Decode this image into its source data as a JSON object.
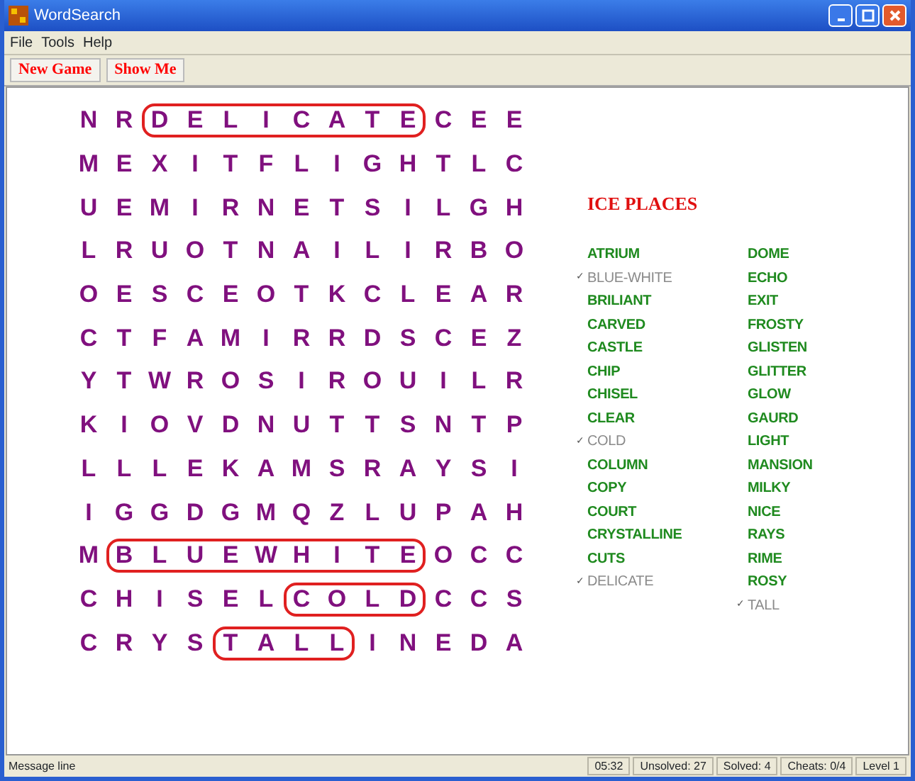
{
  "window": {
    "title": "WordSearch"
  },
  "menu": [
    "File",
    "Tools",
    "Help"
  ],
  "toolbar": [
    "New Game",
    "Show Me"
  ],
  "grid": [
    [
      {
        "letters": [
          "N",
          "R"
        ],
        "circled": false
      },
      {
        "letters": [
          "D",
          "E",
          "L",
          "I",
          "C",
          "A",
          "T",
          "E"
        ],
        "circled": true
      },
      {
        "letters": [
          "C",
          "E",
          "E"
        ],
        "circled": false
      }
    ],
    [
      {
        "letters": [
          "M",
          "E",
          "X",
          "I",
          "T",
          "F",
          "L",
          "I",
          "G",
          "H",
          "T",
          "L",
          "C"
        ],
        "circled": false
      }
    ],
    [
      {
        "letters": [
          "U",
          "E",
          "M",
          "I",
          "R",
          "N",
          "E",
          "T",
          "S",
          "I",
          "L",
          "G",
          "H"
        ],
        "circled": false
      }
    ],
    [
      {
        "letters": [
          "L",
          "R",
          "U",
          "O",
          "T",
          "N",
          "A",
          "I",
          "L",
          "I",
          "R",
          "B",
          "O"
        ],
        "circled": false
      }
    ],
    [
      {
        "letters": [
          "O",
          "E",
          "S",
          "C",
          "E",
          "O",
          "T",
          "K",
          "C",
          "L",
          "E",
          "A",
          "R"
        ],
        "circled": false
      }
    ],
    [
      {
        "letters": [
          "C",
          "T",
          "F",
          "A",
          "M",
          "I",
          "R",
          "R",
          "D",
          "S",
          "C",
          "E",
          "Z"
        ],
        "circled": false
      }
    ],
    [
      {
        "letters": [
          "Y",
          "T",
          "W",
          "R",
          "O",
          "S",
          "I",
          "R",
          "O",
          "U",
          "I",
          "L",
          "R"
        ],
        "circled": false
      }
    ],
    [
      {
        "letters": [
          "K",
          "I",
          "O",
          "V",
          "D",
          "N",
          "U",
          "T",
          "T",
          "S",
          "N",
          "T",
          "P"
        ],
        "circled": false
      }
    ],
    [
      {
        "letters": [
          "L",
          "L",
          "L",
          "E",
          "K",
          "A",
          "M",
          "S",
          "R",
          "A",
          "Y",
          "S",
          "I"
        ],
        "circled": false
      }
    ],
    [
      {
        "letters": [
          "I",
          "G",
          "G",
          "D",
          "G",
          "M",
          "Q",
          "Z",
          "L",
          "U",
          "P",
          "A",
          "H"
        ],
        "circled": false
      }
    ],
    [
      {
        "letters": [
          "M"
        ],
        "circled": false
      },
      {
        "letters": [
          "B",
          "L",
          "U",
          "E",
          "W",
          "H",
          "I",
          "T",
          "E"
        ],
        "circled": true
      },
      {
        "letters": [
          "O",
          "C",
          "C"
        ],
        "circled": false
      }
    ],
    [
      {
        "letters": [
          "C",
          "H",
          "I",
          "S",
          "E",
          "L"
        ],
        "circled": false
      },
      {
        "letters": [
          "C",
          "O",
          "L",
          "D"
        ],
        "circled": true
      },
      {
        "letters": [
          "C",
          "C",
          "S"
        ],
        "circled": false
      }
    ],
    [
      {
        "letters": [
          "C",
          "R",
          "Y",
          "S"
        ],
        "circled": false
      },
      {
        "letters": [
          "T",
          "A",
          "L",
          "L"
        ],
        "circled": true
      },
      {
        "letters": [
          "I",
          "N",
          "E",
          "D",
          "A"
        ],
        "circled": false
      }
    ]
  ],
  "word_list": {
    "title": "ICE PLACES",
    "columns": [
      [
        {
          "word": "ATRIUM",
          "found": false
        },
        {
          "word": "BLUE-WHITE",
          "found": true
        },
        {
          "word": "BRILIANT",
          "found": false
        },
        {
          "word": "CARVED",
          "found": false
        },
        {
          "word": "CASTLE",
          "found": false
        },
        {
          "word": "CHIP",
          "found": false
        },
        {
          "word": "CHISEL",
          "found": false
        },
        {
          "word": "CLEAR",
          "found": false
        },
        {
          "word": "COLD",
          "found": true
        },
        {
          "word": "COLUMN",
          "found": false
        },
        {
          "word": "COPY",
          "found": false
        },
        {
          "word": "COURT",
          "found": false
        },
        {
          "word": "CRYSTALLINE",
          "found": false
        },
        {
          "word": "CUTS",
          "found": false
        },
        {
          "word": "DELICATE",
          "found": true
        }
      ],
      [
        {
          "word": "DOME",
          "found": false
        },
        {
          "word": "ECHO",
          "found": false
        },
        {
          "word": "EXIT",
          "found": false
        },
        {
          "word": "FROSTY",
          "found": false
        },
        {
          "word": "GLISTEN",
          "found": false
        },
        {
          "word": "GLITTER",
          "found": false
        },
        {
          "word": "GLOW",
          "found": false
        },
        {
          "word": "GAURD",
          "found": false
        },
        {
          "word": "LIGHT",
          "found": false
        },
        {
          "word": "MANSION",
          "found": false
        },
        {
          "word": "MILKY",
          "found": false
        },
        {
          "word": "NICE",
          "found": false
        },
        {
          "word": "RAYS",
          "found": false
        },
        {
          "word": "RIME",
          "found": false
        },
        {
          "word": "ROSY",
          "found": false
        },
        {
          "word": "TALL",
          "found": true
        }
      ]
    ],
    "found_mark": "✓"
  },
  "status_bar": {
    "message": "Message line",
    "panels": [
      "05:32",
      "Unsolved: 27",
      "Solved: 4",
      "Cheats: 0/4",
      "Level 1"
    ]
  }
}
